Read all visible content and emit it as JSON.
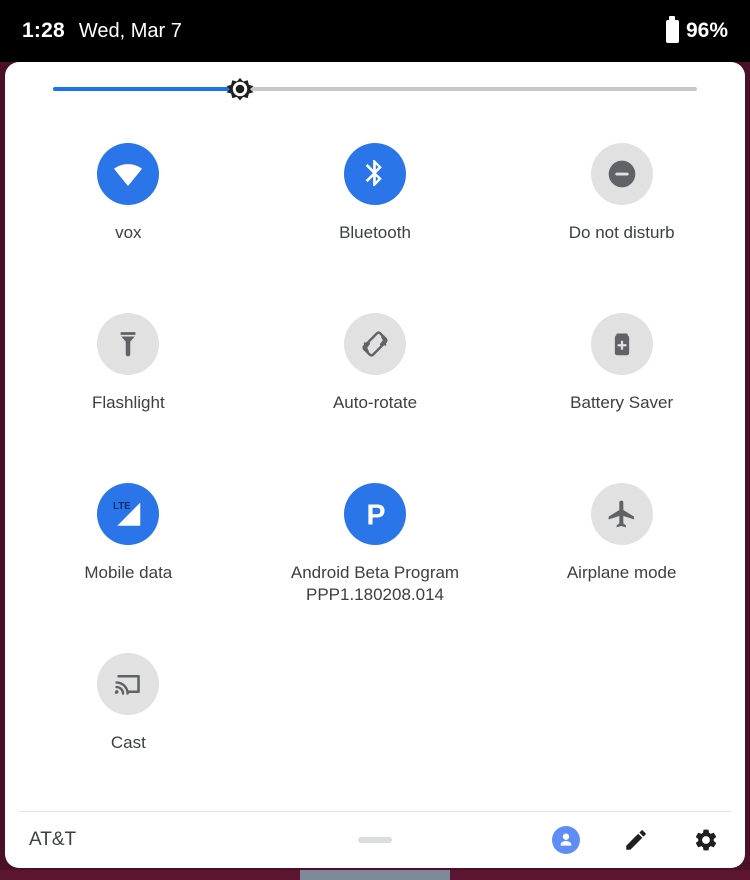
{
  "status_bar": {
    "clock": "1:28",
    "date": "Wed, Mar 7",
    "battery_percent": "96%",
    "battery_icon": "battery-full-icon"
  },
  "brightness": {
    "name": "brightness-slider",
    "value_percent": 29,
    "thumb_icon": "brightness-sun-icon",
    "fill_color": "#1a73e8",
    "track_color": "#c8c8c8"
  },
  "theme": {
    "active_tile_color": "#2a75e8",
    "inactive_tile_color": "#e1e1e1",
    "inactive_icon_color": "#5f6368",
    "label_color": "#3c4043",
    "panel_background": "#ffffff",
    "wallpaper_color": "#4a1028",
    "status_bar_color": "#000000"
  },
  "tiles": [
    {
      "name": "tile-wifi",
      "label": "vox",
      "sublabel": "",
      "icon": "wifi-icon",
      "active": true
    },
    {
      "name": "tile-bluetooth",
      "label": "Bluetooth",
      "sublabel": "",
      "icon": "bluetooth-icon",
      "active": true
    },
    {
      "name": "tile-do-not-disturb",
      "label": "Do not disturb",
      "sublabel": "",
      "icon": "do-not-disturb-icon",
      "active": false
    },
    {
      "name": "tile-flashlight",
      "label": "Flashlight",
      "sublabel": "",
      "icon": "flashlight-icon",
      "active": false
    },
    {
      "name": "tile-auto-rotate",
      "label": "Auto-rotate",
      "sublabel": "",
      "icon": "auto-rotate-icon",
      "active": false
    },
    {
      "name": "tile-battery-saver",
      "label": "Battery Saver",
      "sublabel": "",
      "icon": "battery-saver-icon",
      "active": false
    },
    {
      "name": "tile-mobile-data",
      "label": "Mobile data",
      "sublabel": "",
      "icon": "lte-signal-icon",
      "active": true
    },
    {
      "name": "tile-android-beta-program",
      "label": "Android Beta Program",
      "sublabel": "PPP1.180208.014",
      "icon": "android-beta-p-icon",
      "active": true
    },
    {
      "name": "tile-airplane-mode",
      "label": "Airplane mode",
      "sublabel": "",
      "icon": "airplane-icon",
      "active": false
    },
    {
      "name": "tile-cast",
      "label": "Cast",
      "sublabel": "",
      "icon": "cast-icon",
      "active": false
    }
  ],
  "footer": {
    "carrier": "AT&T",
    "drag_handle": "drag-handle",
    "actions": [
      {
        "name": "user-switcher-button",
        "icon": "user-account-icon"
      },
      {
        "name": "edit-tiles-button",
        "icon": "pencil-icon"
      },
      {
        "name": "settings-button",
        "icon": "gear-icon"
      }
    ]
  }
}
